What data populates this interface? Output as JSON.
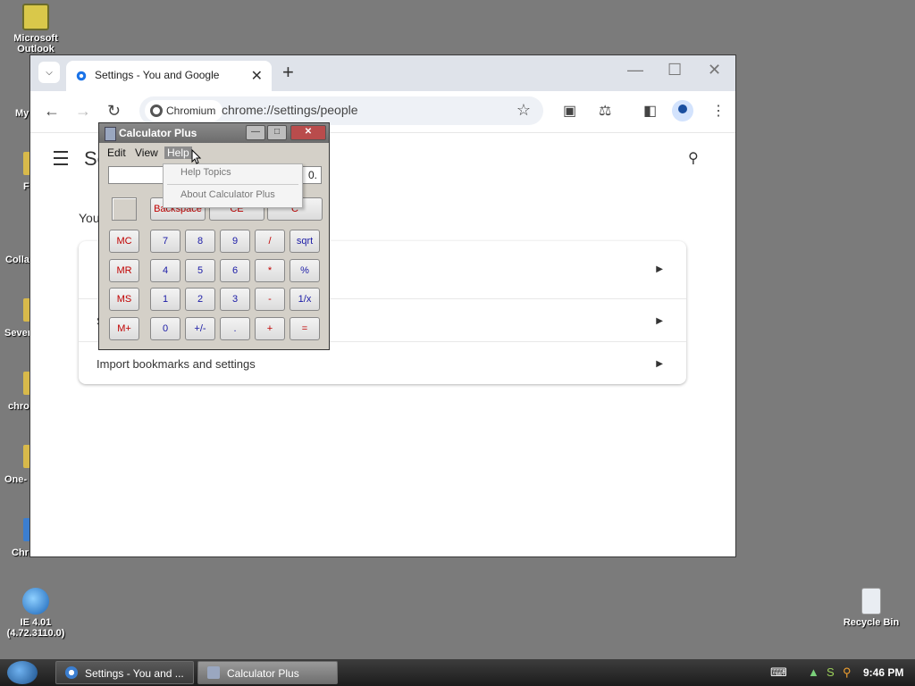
{
  "desktop": {
    "icons": [
      {
        "label": "Microsoft Outlook"
      },
      {
        "label": "IE 4.01 (4.72.3110.0)"
      },
      {
        "label": "Recycle Bin"
      }
    ],
    "partial_labels": [
      "My",
      "F",
      "Colla",
      "Sever",
      "chro",
      "One-",
      "Chr"
    ]
  },
  "browser": {
    "tab_title": "Settings - You and Google",
    "chip_label": "Chromium",
    "url": "chrome://settings/people",
    "page_title_fragment": "Se",
    "section_label_fragment": "You",
    "rows": [
      {
        "label": ""
      },
      {
        "label": "S"
      },
      {
        "label": "Import bookmarks and settings"
      }
    ]
  },
  "calculator": {
    "title": "Calculator Plus",
    "menu": [
      "Edit",
      "View",
      "Help"
    ],
    "display": "0.",
    "help_menu": [
      "Help Topics",
      "About Calculator Plus"
    ],
    "top_row": [
      "Backspace",
      "CE",
      "C"
    ],
    "memory": [
      "MC",
      "MR",
      "MS",
      "M+"
    ],
    "keys": [
      [
        "7",
        "8",
        "9",
        "/",
        "sqrt"
      ],
      [
        "4",
        "5",
        "6",
        "*",
        "%"
      ],
      [
        "1",
        "2",
        "3",
        "-",
        "1/x"
      ],
      [
        "0",
        "+/-",
        ".",
        "+",
        "="
      ]
    ]
  },
  "taskbar": {
    "buttons": [
      "Settings - You and ...",
      "Calculator Plus"
    ],
    "clock": "9:46 PM"
  }
}
